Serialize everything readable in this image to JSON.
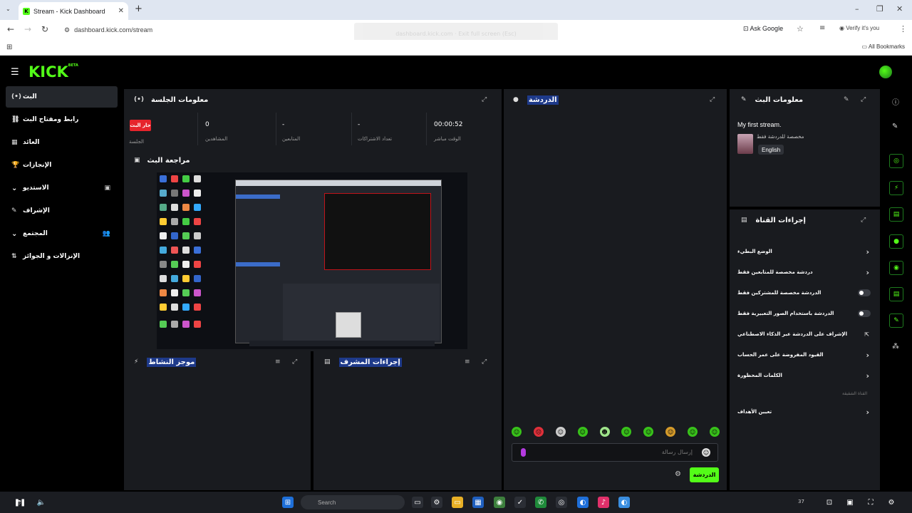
{
  "browser": {
    "tab_title": "Stream - Kick Dashboard",
    "url": "dashboard.kick.com/stream",
    "ask_google": "Ask Google",
    "verify": "Verify it's you",
    "all_bookmarks": "All Bookmarks",
    "toast": "dashboard.kick.com · Exit full screen (Esc)"
  },
  "header": {
    "logo": "KICK",
    "logo_badge": "BETA"
  },
  "sidebar": {
    "items": [
      {
        "label": "البث",
        "icon": "broadcast-icon",
        "glyph": "(•)"
      },
      {
        "label": "رابط ومفتاح البث",
        "icon": "link-icon",
        "glyph": "⛓"
      },
      {
        "label": "العائد",
        "icon": "chart-icon",
        "glyph": "▦"
      },
      {
        "label": "الإنجازات",
        "icon": "trophy-icon",
        "glyph": "🏆"
      },
      {
        "label": "الاستديو",
        "icon": "chevron-down-icon",
        "glyph": "⌄",
        "extra": "▣"
      },
      {
        "label": "الإشراف",
        "icon": "wrench-icon",
        "glyph": "✎"
      },
      {
        "label": "المجتمع",
        "icon": "chevron-down-icon",
        "glyph": "⌄",
        "extra": "👥"
      },
      {
        "label": "الإنزالات و الجوائز",
        "icon": "gift-icon",
        "glyph": "⇅"
      }
    ]
  },
  "session": {
    "title": "معلومات الجلسة",
    "live_badge": "جار البث",
    "session_label": "الجلسة",
    "stats": [
      {
        "value": "0",
        "label": "المشاهدين"
      },
      {
        "value": "-",
        "label": "المتابعين"
      },
      {
        "value": "-",
        "label": "تعداد الاشتراكات"
      },
      {
        "value": "00:00:52",
        "label": "الوقت مباشر"
      }
    ]
  },
  "preview": {
    "title": "مراجعة البث"
  },
  "activity": {
    "title": "موجز النشاط"
  },
  "mod_actions": {
    "title": "إجراءات المشرف"
  },
  "chat": {
    "title": "الدردشة",
    "placeholder": "إرسال رسالة",
    "send_label": "الدردشة"
  },
  "stream_info": {
    "title": "معلومات البث",
    "stream_title": "My first stream.",
    "category": "مخصصة للدردشة فقط",
    "language": "English"
  },
  "channel_actions": {
    "title": "إجراءات القناة",
    "rows": [
      {
        "label": "الوضع البطيء",
        "control": "arrow"
      },
      {
        "label": "دردشة مخصصة للمتابعين فقط",
        "control": "arrow"
      },
      {
        "label": "الدردشة مخصصة للمشتركين فقط",
        "control": "toggle"
      },
      {
        "label": "الدردشة باستخدام الصور التعبيرية فقط",
        "control": "toggle"
      },
      {
        "label": "الإشراف على الدردشة عبر الذكاء الاصطناعي",
        "control": "external"
      },
      {
        "label": "القيود المفروضة على عمر الحساب",
        "control": "arrow"
      },
      {
        "label": "الكلمات المحظورة",
        "control": "arrow"
      }
    ],
    "section_label": "القناة الشقيقة",
    "goal_label": "تعيين الأهداف"
  },
  "taskbar": {
    "search": "Search",
    "count": "37"
  },
  "colors": {
    "brand": "#53fc18",
    "live": "#e6242c",
    "panel": "#191b1f"
  }
}
